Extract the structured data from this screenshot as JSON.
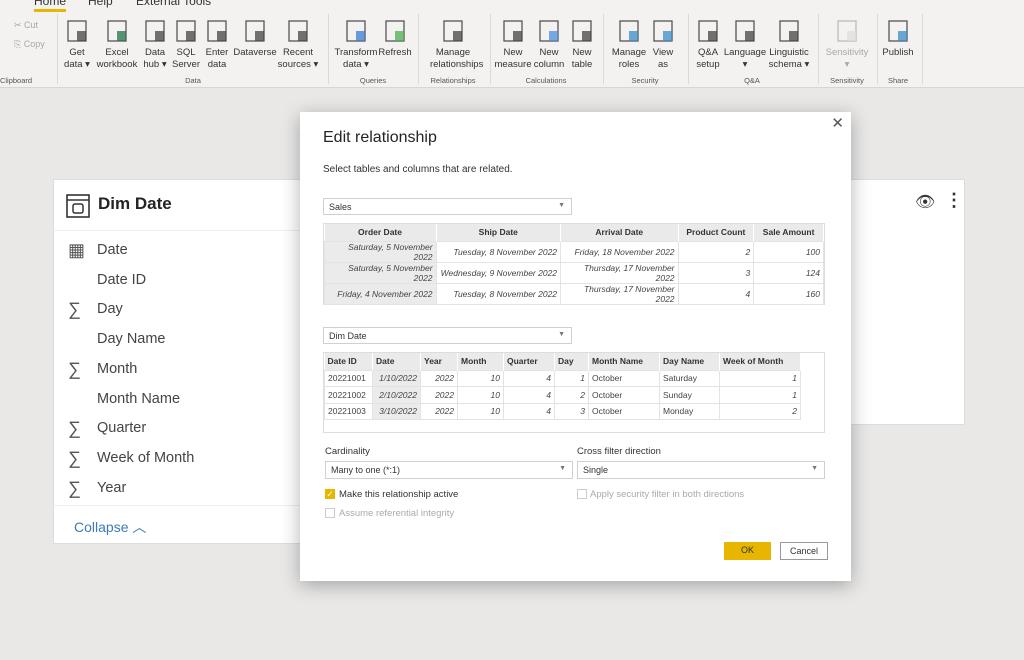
{
  "ribbon": {
    "tabs": [
      "Home",
      "Help",
      "External Tools"
    ],
    "clipboard": {
      "cut": "Cut",
      "copy": "Copy",
      "group": "Clipboard"
    },
    "buttons": [
      {
        "l1": "Get",
        "l2": "data ▾",
        "icon": "database-icon"
      },
      {
        "l1": "Excel",
        "l2": "workbook",
        "icon": "excel-icon"
      },
      {
        "l1": "Data",
        "l2": "hub ▾",
        "icon": "data-hub-icon"
      },
      {
        "l1": "SQL",
        "l2": "Server",
        "icon": "sql-server-icon"
      },
      {
        "l1": "Enter",
        "l2": "data",
        "icon": "table-add-icon"
      },
      {
        "l1": "Dataverse",
        "l2": "",
        "icon": "dataverse-icon"
      },
      {
        "l1": "Recent",
        "l2": "sources ▾",
        "icon": "recent-sources-icon"
      },
      {
        "l1": "Transform",
        "l2": "data ▾",
        "icon": "transform-icon"
      },
      {
        "l1": "Refresh",
        "l2": "",
        "icon": "refresh-icon"
      },
      {
        "l1": "Manage",
        "l2": "relationships",
        "icon": "relationships-icon"
      },
      {
        "l1": "New",
        "l2": "measure",
        "icon": "calculator-icon"
      },
      {
        "l1": "New",
        "l2": "column",
        "icon": "column-icon"
      },
      {
        "l1": "New",
        "l2": "table",
        "icon": "table-icon"
      },
      {
        "l1": "Manage",
        "l2": "roles",
        "icon": "roles-icon"
      },
      {
        "l1": "View",
        "l2": "as",
        "icon": "view-as-icon"
      },
      {
        "l1": "Q&A",
        "l2": "setup",
        "icon": "qa-icon"
      },
      {
        "l1": "Language",
        "l2": "▾",
        "icon": "language-icon"
      },
      {
        "l1": "Linguistic",
        "l2": "schema ▾",
        "icon": "linguistic-icon"
      },
      {
        "l1": "Sensitivity",
        "l2": "▾",
        "icon": "sensitivity-icon"
      },
      {
        "l1": "Publish",
        "l2": "",
        "icon": "publish-icon"
      }
    ],
    "groups": [
      "Data",
      "Queries",
      "Relationships",
      "Calculations",
      "Security",
      "Q&A",
      "Sensitivity",
      "Share"
    ]
  },
  "card": {
    "title": "Dim Date",
    "fields": [
      {
        "name": "Date",
        "icon": "calendar"
      },
      {
        "name": "Date ID",
        "icon": ""
      },
      {
        "name": "Day",
        "icon": "sigma"
      },
      {
        "name": "Day Name",
        "icon": ""
      },
      {
        "name": "Month",
        "icon": "sigma"
      },
      {
        "name": "Month Name",
        "icon": ""
      },
      {
        "name": "Quarter",
        "icon": "sigma"
      },
      {
        "name": "Week of Month",
        "icon": "sigma"
      },
      {
        "name": "Year",
        "icon": "sigma"
      }
    ],
    "collapse": "Collapse"
  },
  "dialog": {
    "title": "Edit relationship",
    "subtitle": "Select tables and columns that are related.",
    "table1": {
      "name": "Sales",
      "columns": [
        "Order Date",
        "Ship Date",
        "Arrival Date",
        "Product Count",
        "Sale Amount"
      ],
      "rows": [
        [
          "Saturday, 5 November 2022",
          "Tuesday, 8 November 2022",
          "Friday, 18 November 2022",
          "2",
          "100"
        ],
        [
          "Saturday, 5 November 2022",
          "Wednesday, 9 November 2022",
          "Thursday, 17 November 2022",
          "3",
          "124"
        ],
        [
          "Friday, 4 November 2022",
          "Tuesday, 8 November 2022",
          "Thursday, 17 November 2022",
          "4",
          "160"
        ]
      ]
    },
    "table2": {
      "name": "Dim Date",
      "columns": [
        "Date ID",
        "Date",
        "Year",
        "Month",
        "Quarter",
        "Day",
        "Month Name",
        "Day Name",
        "Week of Month"
      ],
      "rows": [
        [
          "20221001",
          "1/10/2022",
          "2022",
          "10",
          "4",
          "1",
          "October",
          "Saturday",
          "1"
        ],
        [
          "20221002",
          "2/10/2022",
          "2022",
          "10",
          "4",
          "2",
          "October",
          "Sunday",
          "1"
        ],
        [
          "20221003",
          "3/10/2022",
          "2022",
          "10",
          "4",
          "3",
          "October",
          "Monday",
          "2"
        ]
      ]
    },
    "cardinality_label": "Cardinality",
    "cardinality": "Many to one (*:1)",
    "crossfilter_label": "Cross filter direction",
    "crossfilter": "Single",
    "active": {
      "label": "Make this relationship active",
      "checked": true
    },
    "referential": {
      "label": "Assume referential integrity",
      "checked": false
    },
    "security": {
      "label": "Apply security filter in both directions",
      "checked": false
    },
    "ok": "OK",
    "cancel": "Cancel",
    "accent": "#e8b500"
  }
}
